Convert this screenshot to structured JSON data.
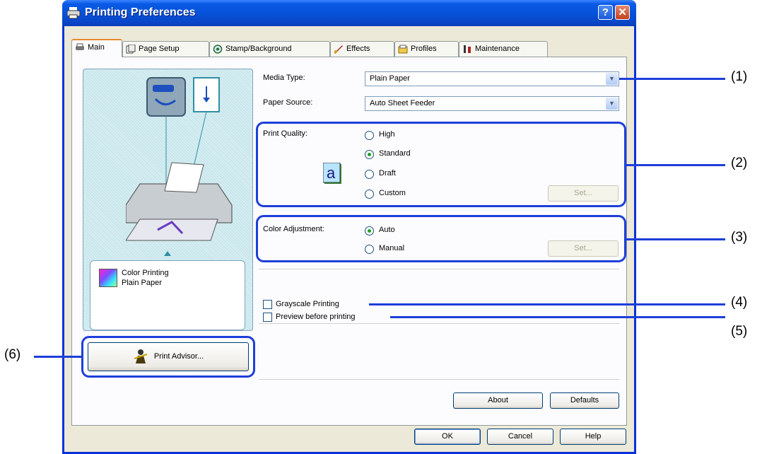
{
  "window": {
    "title": "Printing Preferences",
    "help_glyph": "?",
    "close_glyph": "✕"
  },
  "tabs": [
    {
      "label": "Main",
      "icon": "printer-icon"
    },
    {
      "label": "Page Setup",
      "icon": "pages-icon"
    },
    {
      "label": "Stamp/Background",
      "icon": "stamp-icon"
    },
    {
      "label": "Effects",
      "icon": "brush-icon"
    },
    {
      "label": "Profiles",
      "icon": "profiles-icon"
    },
    {
      "label": "Maintenance",
      "icon": "tools-icon"
    }
  ],
  "preview": {
    "status_line1": "Color Printing",
    "status_line2": "Plain Paper",
    "print_advisor": "Print Advisor..."
  },
  "media": {
    "label": "Media Type:",
    "value": "Plain Paper"
  },
  "source": {
    "label": "Paper Source:",
    "value": "Auto Sheet Feeder"
  },
  "quality": {
    "label": "Print Quality:",
    "options": [
      "High",
      "Standard",
      "Draft",
      "Custom"
    ],
    "selected": "Standard",
    "set_button": "Set..."
  },
  "color": {
    "label": "Color Adjustment:",
    "options": [
      "Auto",
      "Manual"
    ],
    "selected": "Auto",
    "set_button": "Set..."
  },
  "grayscale": {
    "label": "Grayscale Printing",
    "checked": false
  },
  "preview_before": {
    "label": "Preview before printing",
    "checked": false
  },
  "buttons": {
    "about": "About",
    "defaults": "Defaults",
    "ok": "OK",
    "cancel": "Cancel",
    "help": "Help"
  },
  "callouts": [
    "(1)",
    "(2)",
    "(3)",
    "(4)",
    "(5)",
    "(6)"
  ],
  "colors": {
    "accent_blue": "#1d3fd9",
    "title_blue": "#0652d9",
    "face": "#ece9d8"
  }
}
